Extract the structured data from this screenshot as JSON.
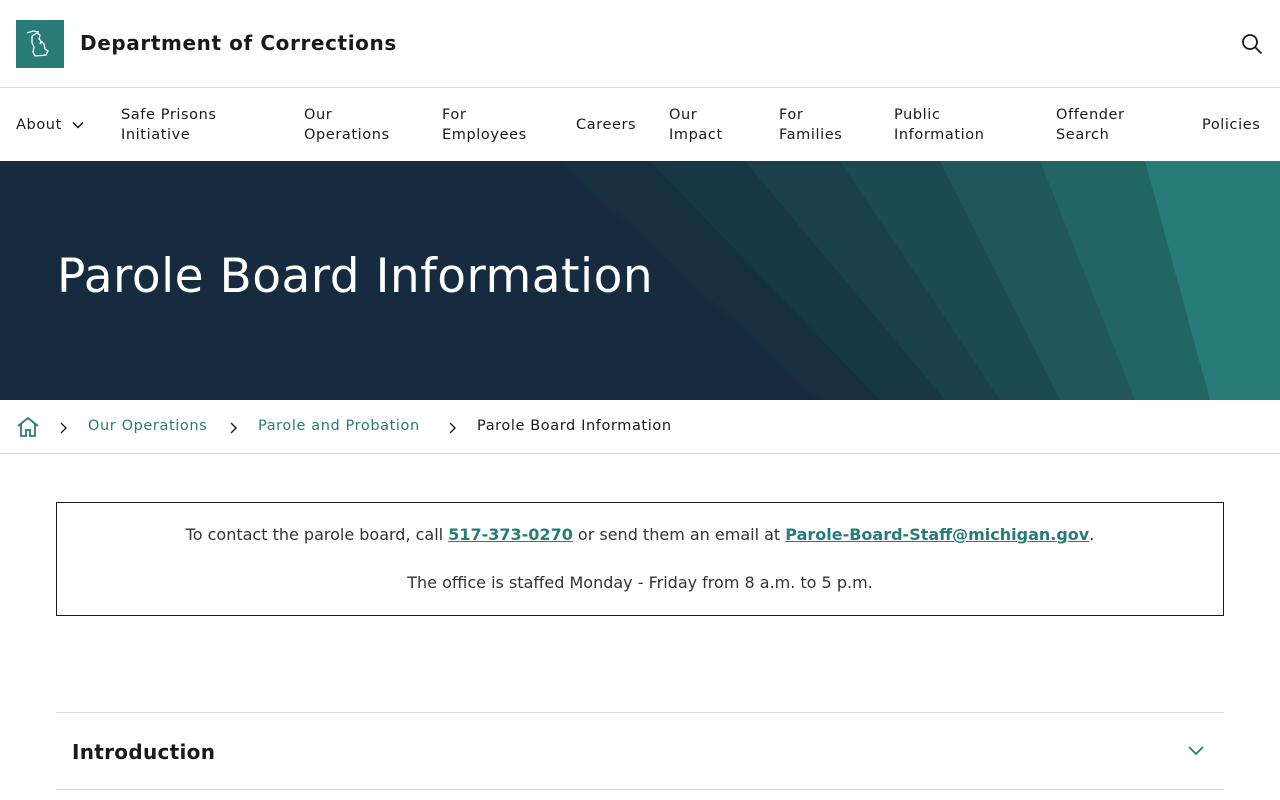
{
  "header": {
    "site_title": "Department of Corrections",
    "logo_icon": "michigan-state-icon",
    "search_icon": "search-icon"
  },
  "nav": {
    "items": [
      {
        "label": "About"
      },
      {
        "label": "Safe Prisons Initiative"
      },
      {
        "label": "Our Operations"
      },
      {
        "label": "For Employees"
      },
      {
        "label": "Careers"
      },
      {
        "label": "Our Impact"
      },
      {
        "label": "For Families"
      },
      {
        "label": "Public Information"
      },
      {
        "label": "Offender Search"
      },
      {
        "label": "Policies"
      }
    ]
  },
  "hero": {
    "title": "Parole Board Information"
  },
  "breadcrumb": {
    "home_icon": "home-icon",
    "links": [
      "Our Operations",
      "Parole and Probation"
    ],
    "current": "Parole Board Information"
  },
  "contact": {
    "line1_prefix": "To contact the parole board, call ",
    "phone": "517-373-0270",
    "line1_middle": " or send them an email at ",
    "email": "Parole-Board-Staff@michigan.gov",
    "line1_suffix": ".",
    "line2": "The office is staffed Monday - Friday from 8 a.m. to 5 p.m."
  },
  "accordion": {
    "title": "Introduction",
    "icon": "chevron-down-icon"
  },
  "colors": {
    "accent": "#277c78",
    "hero_bg": "#162b40",
    "text": "#1a1a1a"
  }
}
